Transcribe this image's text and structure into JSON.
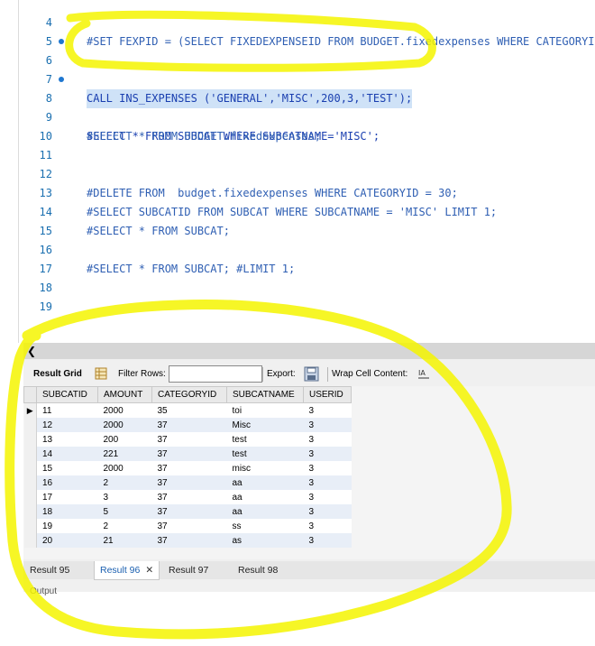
{
  "editor": {
    "lines": [
      {
        "n": "4",
        "text": "#SET FEXPID = (SELECT FIXEDEXPENSEID FROM BUDGET.fixedexpenses WHERE CATEGORYID I"
      },
      {
        "n": "5",
        "text": ""
      },
      {
        "n": "6",
        "text": "CALL INS_EXPENSES ('GENERAL','MISC',200,3,'TEST');"
      },
      {
        "n": "7",
        "text": ""
      },
      {
        "n": "8",
        "text": "SELECT * FROM SUBCAT WHERE SUBCATNAME='MISC';"
      },
      {
        "n": "9",
        "text": "#SELECT * FROM BUDGET.fixedexpenses;"
      },
      {
        "n": "10",
        "text": ""
      },
      {
        "n": "11",
        "text": ""
      },
      {
        "n": "12",
        "text": "#DELETE FROM  budget.fixedexpenses WHERE CATEGORYID = 30;"
      },
      {
        "n": "13",
        "text": "#SELECT SUBCATID FROM SUBCAT WHERE SUBCATNAME = 'MISC' LIMIT 1;"
      },
      {
        "n": "14",
        "text": "#SELECT * FROM SUBCAT;"
      },
      {
        "n": "15",
        "text": ""
      },
      {
        "n": "16",
        "text": "#SELECT * FROM SUBCAT; #LIMIT 1;"
      },
      {
        "n": "17",
        "text": ""
      },
      {
        "n": "18",
        "text": ""
      },
      {
        "n": "19",
        "text": ""
      }
    ]
  },
  "toolbar": {
    "result_grid": "Result Grid",
    "filter_rows": "Filter Rows:",
    "filter_value": "",
    "export": "Export:",
    "wrap": "Wrap Cell Content:"
  },
  "grid": {
    "columns": [
      "SUBCATID",
      "AMOUNT",
      "CATEGORYID",
      "SUBCATNAME",
      "USERID"
    ],
    "rows": [
      [
        "11",
        "2000",
        "35",
        "toi",
        "3"
      ],
      [
        "12",
        "2000",
        "37",
        "Misc",
        "3"
      ],
      [
        "13",
        "200",
        "37",
        "test",
        "3"
      ],
      [
        "14",
        "221",
        "37",
        "test",
        "3"
      ],
      [
        "15",
        "2000",
        "37",
        "misc",
        "3"
      ],
      [
        "16",
        "2",
        "37",
        "aa",
        "3"
      ],
      [
        "17",
        "3",
        "37",
        "aa",
        "3"
      ],
      [
        "18",
        "5",
        "37",
        "aa",
        "3"
      ],
      [
        "19",
        "2",
        "37",
        "ss",
        "3"
      ],
      [
        "20",
        "21",
        "37",
        "as",
        "3"
      ]
    ]
  },
  "tabs": [
    {
      "label": "Result 95"
    },
    {
      "label": "Result 96",
      "active": true
    },
    {
      "label": "Result 97"
    },
    {
      "label": "Result 98"
    }
  ],
  "tab_close": "✕",
  "output_label": "Output",
  "colors": {
    "highlighter": "#f5f500",
    "selection": "#cfe2f7",
    "line_number": "#1a6fb0"
  }
}
